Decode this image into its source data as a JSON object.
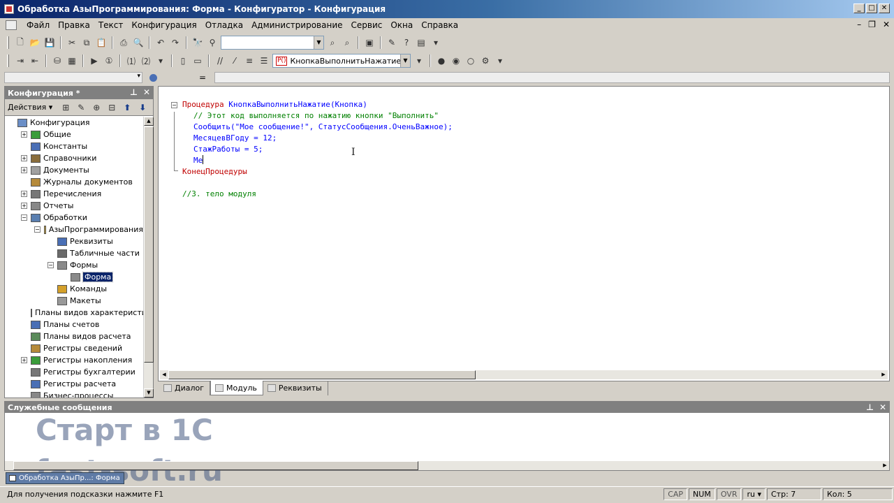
{
  "window": {
    "title": "Обработка АзыПрограммирования: Форма - Конфигуратор - Конфигурация",
    "minimize": "_",
    "maximize": "□",
    "close": "✕"
  },
  "menu": [
    "Файл",
    "Правка",
    "Текст",
    "Конфигурация",
    "Отладка",
    "Администрирование",
    "Сервис",
    "Окна",
    "Справка"
  ],
  "toolbar2": {
    "procedure_tag": "P()",
    "procedure_value": "КнопкаВыполнитьНажатие"
  },
  "left_panel": {
    "title": "Конфигурация *",
    "actions_label": "Действия",
    "tree": [
      {
        "label": "Конфигурация",
        "level": 0,
        "exp": "",
        "icon": "config-icon",
        "color": "#6b8fc7"
      },
      {
        "label": "Общие",
        "level": 1,
        "exp": "+",
        "icon": "common-icon",
        "color": "#3a9c3a"
      },
      {
        "label": "Константы",
        "level": 1,
        "exp": "",
        "icon": "constants-icon",
        "color": "#4a6fb5"
      },
      {
        "label": "Справочники",
        "level": 1,
        "exp": "+",
        "icon": "catalogs-icon",
        "color": "#8a6d3b"
      },
      {
        "label": "Документы",
        "level": 1,
        "exp": "+",
        "icon": "documents-icon",
        "color": "#a0a0a0"
      },
      {
        "label": "Журналы документов",
        "level": 1,
        "exp": "",
        "icon": "journals-icon",
        "color": "#b58a3a"
      },
      {
        "label": "Перечисления",
        "level": 1,
        "exp": "+",
        "icon": "enums-icon",
        "color": "#777"
      },
      {
        "label": "Отчеты",
        "level": 1,
        "exp": "+",
        "icon": "reports-icon",
        "color": "#888"
      },
      {
        "label": "Обработки",
        "level": 1,
        "exp": "−",
        "icon": "processings-icon",
        "color": "#5a7fb0"
      },
      {
        "label": "АзыПрограммирования",
        "level": 2,
        "exp": "−",
        "icon": "processing-icon",
        "color": "#c9a43a"
      },
      {
        "label": "Реквизиты",
        "level": 3,
        "exp": "",
        "icon": "attributes-icon",
        "color": "#4a6fb5"
      },
      {
        "label": "Табличные части",
        "level": 3,
        "exp": "",
        "icon": "tabular-icon",
        "color": "#6a6a6a"
      },
      {
        "label": "Формы",
        "level": 3,
        "exp": "−",
        "icon": "forms-icon",
        "color": "#8a8a8a"
      },
      {
        "label": "Форма",
        "level": 4,
        "exp": "",
        "icon": "form-icon",
        "color": "#8a8a8a",
        "selected": true
      },
      {
        "label": "Команды",
        "level": 3,
        "exp": "",
        "icon": "commands-icon",
        "color": "#d4a02a"
      },
      {
        "label": "Макеты",
        "level": 3,
        "exp": "",
        "icon": "templates-icon",
        "color": "#999"
      },
      {
        "label": "Планы видов характеристик",
        "level": 1,
        "exp": "",
        "icon": "chart-types-icon",
        "color": "#888"
      },
      {
        "label": "Планы счетов",
        "level": 1,
        "exp": "",
        "icon": "accounts-icon",
        "color": "#4a6fb5"
      },
      {
        "label": "Планы видов расчета",
        "level": 1,
        "exp": "",
        "icon": "calc-types-icon",
        "color": "#5a8a5a"
      },
      {
        "label": "Регистры сведений",
        "level": 1,
        "exp": "",
        "icon": "info-registers-icon",
        "color": "#b58a3a"
      },
      {
        "label": "Регистры накопления",
        "level": 1,
        "exp": "+",
        "icon": "accum-registers-icon",
        "color": "#3a9c3a"
      },
      {
        "label": "Регистры бухгалтерии",
        "level": 1,
        "exp": "",
        "icon": "account-registers-icon",
        "color": "#777"
      },
      {
        "label": "Регистры расчета",
        "level": 1,
        "exp": "",
        "icon": "calc-registers-icon",
        "color": "#4a6fb5"
      },
      {
        "label": "Бизнес-процессы",
        "level": 1,
        "exp": "",
        "icon": "business-processes-icon",
        "color": "#888"
      }
    ]
  },
  "editor": {
    "lines": [
      {
        "indent": 0,
        "parts": [
          {
            "t": "kw",
            "v": "Процедура "
          },
          {
            "t": "id",
            "v": "КнопкаВыполнитьНажатие"
          },
          {
            "t": "id",
            "v": "(Кнопка)"
          }
        ]
      },
      {
        "indent": 1,
        "parts": [
          {
            "t": "cm",
            "v": "// Этот код выполняется по нажатию кнопки \"Выполнить\""
          }
        ]
      },
      {
        "indent": 1,
        "parts": [
          {
            "t": "id",
            "v": "Сообщить(\"Мое сообщение!\", СтатусСообщения.ОченьВажное);"
          }
        ]
      },
      {
        "indent": 1,
        "parts": [
          {
            "t": "id",
            "v": "МесяцевВГоду = 12;"
          }
        ]
      },
      {
        "indent": 1,
        "parts": [
          {
            "t": "id",
            "v": "СтажРаботы = 5;"
          }
        ]
      },
      {
        "indent": 1,
        "parts": [
          {
            "t": "id",
            "v": "Ме"
          }
        ],
        "caret": true
      },
      {
        "indent": 0,
        "parts": [
          {
            "t": "kw",
            "v": "КонецПроцедуры"
          }
        ]
      },
      {
        "indent": 0,
        "parts": []
      },
      {
        "indent": 0,
        "parts": [
          {
            "t": "cm",
            "v": "//3. тело модуля"
          }
        ]
      }
    ],
    "tabs": [
      {
        "label": "Диалог",
        "active": false
      },
      {
        "label": "Модуль",
        "active": true
      },
      {
        "label": "Реквизиты",
        "active": false
      }
    ]
  },
  "messages": {
    "title": "Служебные сообщения",
    "watermark_line1": "Старт в 1С",
    "watermark_line2": "fast-soft.ru"
  },
  "taskbar": {
    "label": "Обработка АзыПр...: Форма"
  },
  "status": {
    "hint": "Для получения подсказки нажмите F1",
    "cap": "CAP",
    "num": "NUM",
    "ovr": "OVR",
    "lang": "ru",
    "row": "Стр: 7",
    "col": "Кол: 5"
  }
}
